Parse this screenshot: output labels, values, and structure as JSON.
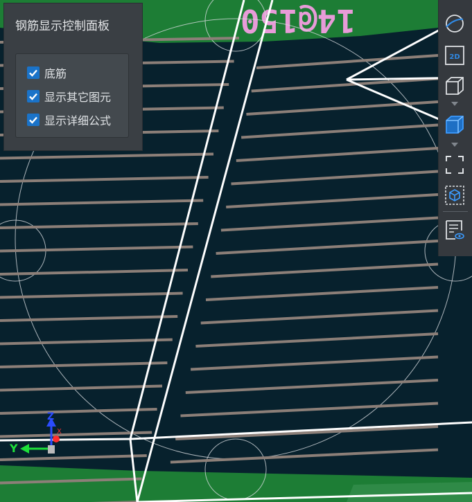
{
  "panel": {
    "title": "钢筋显示控制面板",
    "options": [
      {
        "label": "底筋",
        "checked": true
      },
      {
        "label": "显示其它图元",
        "checked": true
      },
      {
        "label": "显示详细公式",
        "checked": true
      }
    ]
  },
  "scene": {
    "annotation": "14@150",
    "axes": {
      "y": "Y",
      "z": "Z",
      "x": "X"
    }
  },
  "toolbar": {
    "items": [
      {
        "name": "rotate-view-button",
        "icon": "orbit-icon"
      },
      {
        "name": "2d-view-button",
        "icon": "2d-icon",
        "label": "2D"
      },
      {
        "name": "3d-view-button",
        "icon": "cube-outline-icon"
      },
      {
        "name": "3d-shaded-view-button",
        "icon": "cube-filled-icon"
      },
      {
        "name": "fit-view-button",
        "icon": "fullscreen-icon"
      },
      {
        "name": "zoom-selection-button",
        "icon": "cube-select-icon"
      },
      {
        "name": "display-settings-button",
        "icon": "list-eye-icon"
      }
    ]
  },
  "colors": {
    "background": "#07212d",
    "green_face": "#1d7d35",
    "rebar": "#8c7f78",
    "annotation": "#e89bd8",
    "accent": "#1a73c9",
    "panel": "#3a3f44"
  }
}
